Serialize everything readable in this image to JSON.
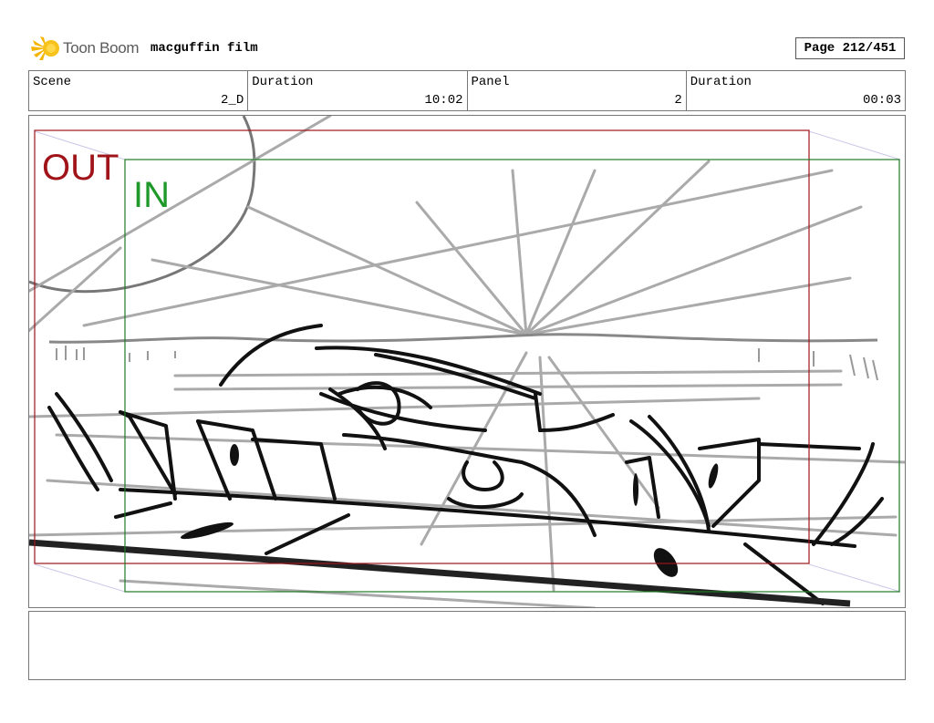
{
  "header": {
    "logo_text": "Toon Boom",
    "project_title": "macguffin film",
    "page_label": "Page 212/451"
  },
  "info": {
    "scene_label": "Scene",
    "scene_value": "2_D",
    "scene_duration_label": "Duration",
    "scene_duration_value": "10:02",
    "panel_label": "Panel",
    "panel_value": "2",
    "panel_duration_label": "Duration",
    "panel_duration_value": "00:03"
  },
  "frames": {
    "out_label": "OUT",
    "out_color": "#a01419",
    "in_label": "IN",
    "in_color": "#1f9a2a"
  },
  "notes": {
    "text": ""
  }
}
